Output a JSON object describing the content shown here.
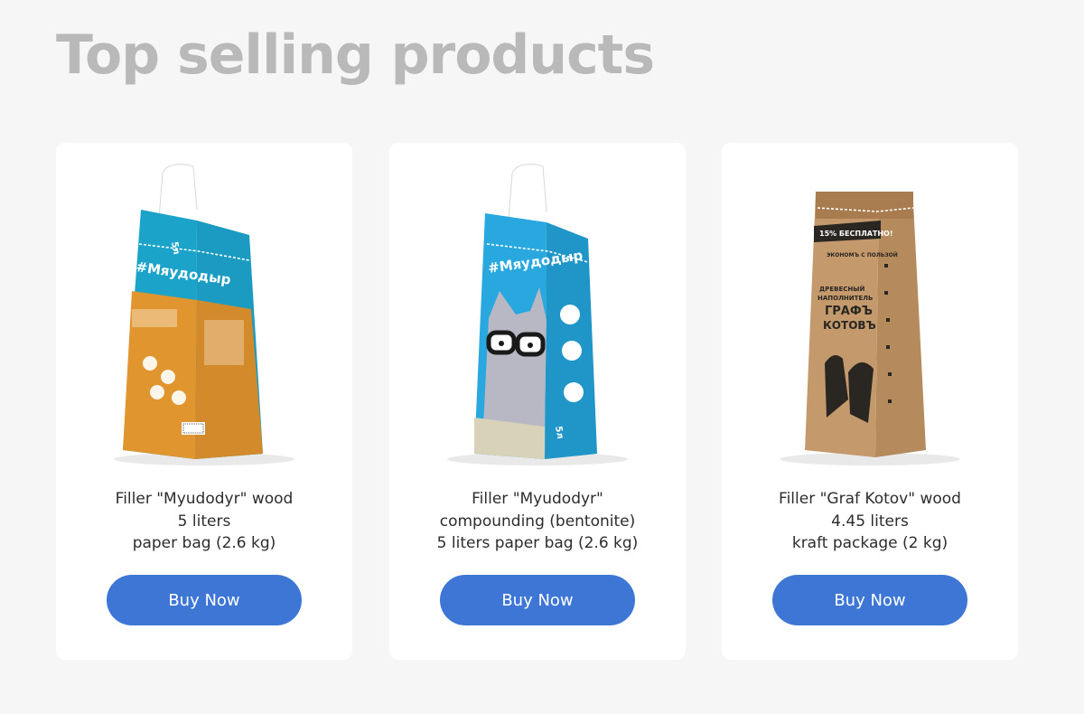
{
  "page": {
    "title": "Top selling products"
  },
  "products": [
    {
      "name_lines": [
        "Filler \"Myudodyr\" wood",
        "5 liters",
        "paper bag (2.6 kg)"
      ],
      "buy_label": "Buy Now",
      "bag_brand": "#Мяудодыр",
      "bag_volume": "5л",
      "bag_color": "#1ba3c9"
    },
    {
      "name_lines": [
        "Filler \"Myudodyr\"",
        "compounding (bentonite)",
        "5 liters paper bag (2.6 kg)"
      ],
      "buy_label": "Buy Now",
      "bag_brand": "#Мяудодыр",
      "bag_volume": "5л",
      "bag_color": "#28a8df"
    },
    {
      "name_lines": [
        "Filler \"Graf Kotov\" wood",
        "4.45 liters",
        "kraft package (2 kg)"
      ],
      "buy_label": "Buy Now",
      "bag_banner": "15% БЕСПЛАТНО!",
      "bag_tag": "ЭКОНОМЪ С ПОЛЬЗОЙ",
      "bag_brand_lines": [
        "ДРЕВЕСНЫЙ",
        "НАПОЛНИТЕЛЬ",
        "ГРАФЪ",
        "КОТОВЪ"
      ],
      "bag_color": "#c49a6c"
    }
  ],
  "colors": {
    "accent": "#3e76d6",
    "title": "#b9b9b9",
    "background": "#f6f6f7"
  }
}
